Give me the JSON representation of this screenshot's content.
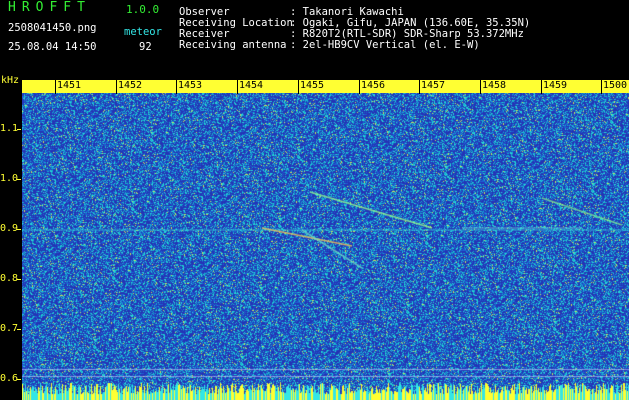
{
  "app": {
    "title": "HROFFT",
    "version": "1.0.0"
  },
  "file": {
    "name": "2508041450.png",
    "datetime": "25.08.04 14:50"
  },
  "mode": {
    "label": "meteor",
    "count": "92"
  },
  "info": [
    {
      "key": "Observer",
      "value": ": Takanori Kawachi"
    },
    {
      "key": "Receiving Location",
      "value": ": Ogaki, Gifu, JAPAN (136.60E, 35.35N)"
    },
    {
      "key": "Receiver",
      "value": ": R820T2(RTL-SDR) SDR-Sharp 53.372MHz"
    },
    {
      "key": "Receiving antenna",
      "value": ": 2el-HB9CV Vertical (el. E-W)"
    }
  ],
  "y_axis": {
    "unit": "kHz",
    "ticks": [
      "1.1",
      "1.0",
      "0.9",
      "0.8",
      "0.7",
      "0.6"
    ]
  },
  "x_axis": {
    "ticks": [
      "1451",
      "1452",
      "1453",
      "1454",
      "1455",
      "1456",
      "1457",
      "1458",
      "1459",
      "1500"
    ]
  },
  "colors": {
    "background": "#2a3cb8",
    "noise": "#1ad6d6",
    "timebar": "#ffff33",
    "axis_text": "#ffff33"
  }
}
